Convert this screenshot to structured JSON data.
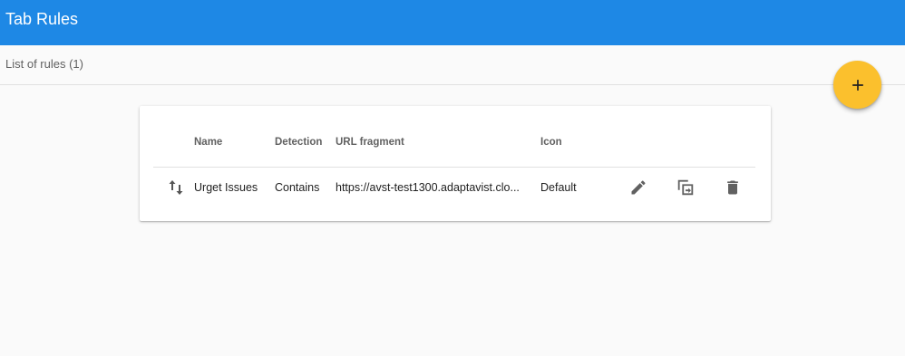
{
  "app": {
    "title": "Tab Rules"
  },
  "subheader": {
    "text": "List of rules (1)"
  },
  "fab": {
    "icon": "plus-icon",
    "color": "#fbc02d"
  },
  "colors": {
    "app_bar": "#1e88e5",
    "background": "#fafafa"
  },
  "table": {
    "columns": [
      "Name",
      "Detection",
      "URL fragment",
      "Icon"
    ],
    "rows": [
      {
        "name": "Urget Issues",
        "detection": "Contains",
        "url_fragment": "https://avst-test1300.adaptavist.clo...",
        "icon": "Default",
        "actions": [
          "edit-icon",
          "copy-icon",
          "delete-icon"
        ]
      }
    ]
  }
}
